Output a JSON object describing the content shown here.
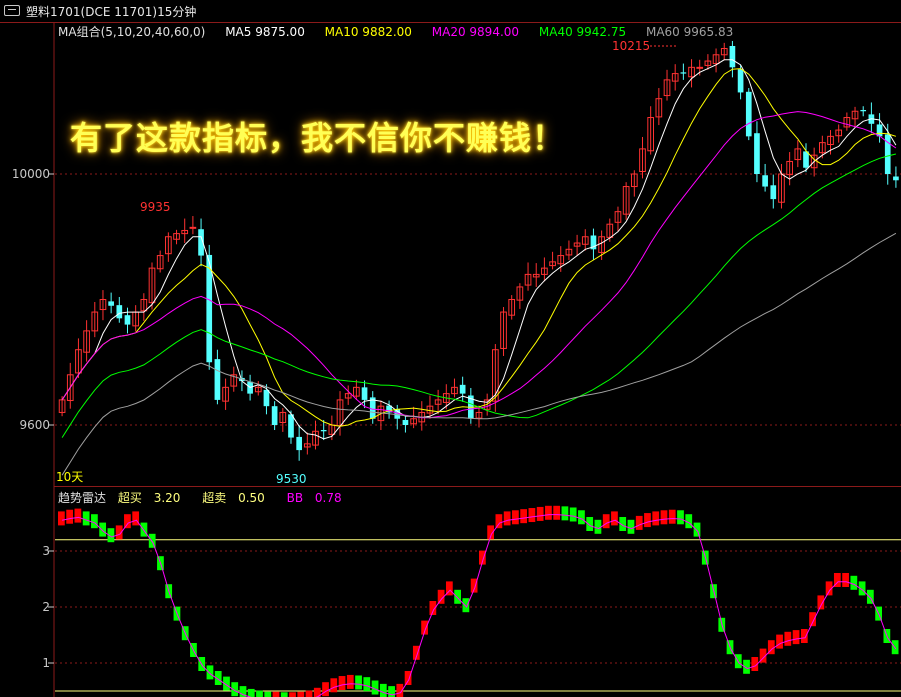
{
  "window": {
    "title": "塑料1701(DCE 11701)15分钟"
  },
  "ma_legend": {
    "group_label": "MA组合(5,10,20,40,60,0)",
    "items": [
      {
        "label": "MA5 9875.00",
        "color": "#ffffff"
      },
      {
        "label": "MA10 9882.00",
        "color": "#ffff00"
      },
      {
        "label": "MA20 9894.00",
        "color": "#ff00ff"
      },
      {
        "label": "MA40 9942.75",
        "color": "#00ff00"
      },
      {
        "label": "MA60 9965.83",
        "color": "#a0a0a0"
      }
    ]
  },
  "annotations": {
    "headline": "有了这款指标，我不信你不赚钱！",
    "high_label": "10215",
    "low_label": "9530",
    "peak_label": "9935",
    "period_label": "10天"
  },
  "indicator_legend": {
    "name": "趋势雷达",
    "overbuy_label": "超买",
    "overbuy_value": "3.20",
    "oversell_label": "超卖",
    "oversell_value": "0.50",
    "bb_label": "BB",
    "bb_value": "0.78"
  },
  "colors": {
    "up": "#ff3232",
    "down": "#54ffff",
    "grid": "#8b1a1a",
    "bar_up": "#ff0000",
    "bar_down": "#00ff00",
    "bb_line": "#ff00ff",
    "threshold": "#ffff80"
  },
  "chart_data": [
    {
      "type": "candlestick",
      "title": "塑料1701(DCE 11701)15分钟",
      "y_ticks": [
        "10000",
        "9600"
      ],
      "ylim": [
        9480,
        10280
      ],
      "close": [
        9640,
        9680,
        9720,
        9750,
        9780,
        9800,
        9790,
        9770,
        9760,
        9780,
        9800,
        9850,
        9870,
        9900,
        9905,
        9910,
        9915,
        9870,
        9700,
        9640,
        9660,
        9680,
        9670,
        9650,
        9660,
        9630,
        9600,
        9620,
        9580,
        9560,
        9570,
        9590,
        9590,
        9600,
        9640,
        9650,
        9660,
        9640,
        9610,
        9630,
        9620,
        9610,
        9600,
        9610,
        9620,
        9630,
        9640,
        9650,
        9660,
        9650,
        9610,
        9620,
        9640,
        9720,
        9780,
        9800,
        9820,
        9840,
        9840,
        9850,
        9860,
        9870,
        9880,
        9890,
        9900,
        9880,
        9900,
        9920,
        9940,
        9980,
        10000,
        10040,
        10090,
        10120,
        10150,
        10160,
        10160,
        10170,
        10170,
        10180,
        10190,
        10200,
        10170,
        10130,
        10060,
        10000,
        9980,
        9960,
        10000,
        10020,
        10040,
        10010,
        10030,
        10050,
        10060,
        10070,
        10090,
        10100,
        10100,
        10080,
        10060,
        10000,
        9990
      ]
    },
    {
      "type": "bar",
      "title": "趋势雷达",
      "y_ticks": [
        "3",
        "2",
        "1"
      ],
      "ylim": [
        0.4,
        3.8
      ],
      "thresholds": {
        "overbuy": 3.2,
        "oversell": 0.5
      },
      "values": [
        3.6,
        3.63,
        3.65,
        3.6,
        3.55,
        3.4,
        3.3,
        3.35,
        3.55,
        3.6,
        3.4,
        3.2,
        2.8,
        2.3,
        1.9,
        1.55,
        1.25,
        1.0,
        0.85,
        0.75,
        0.65,
        0.55,
        0.48,
        0.43,
        0.4,
        0.38,
        0.38,
        0.37,
        0.37,
        0.38,
        0.4,
        0.45,
        0.55,
        0.62,
        0.66,
        0.68,
        0.67,
        0.64,
        0.58,
        0.52,
        0.48,
        0.52,
        0.75,
        1.2,
        1.65,
        2.0,
        2.2,
        2.35,
        2.2,
        2.05,
        2.4,
        2.9,
        3.35,
        3.55,
        3.6,
        3.62,
        3.64,
        3.66,
        3.68,
        3.7,
        3.7,
        3.69,
        3.67,
        3.62,
        3.5,
        3.45,
        3.55,
        3.6,
        3.5,
        3.45,
        3.52,
        3.57,
        3.6,
        3.62,
        3.63,
        3.62,
        3.55,
        3.4,
        2.9,
        2.3,
        1.7,
        1.3,
        1.05,
        0.95,
        1.0,
        1.15,
        1.3,
        1.4,
        1.45,
        1.48,
        1.5,
        1.8,
        2.1,
        2.35,
        2.5,
        2.5,
        2.45,
        2.35,
        2.2,
        1.9,
        1.5,
        1.3
      ]
    }
  ]
}
